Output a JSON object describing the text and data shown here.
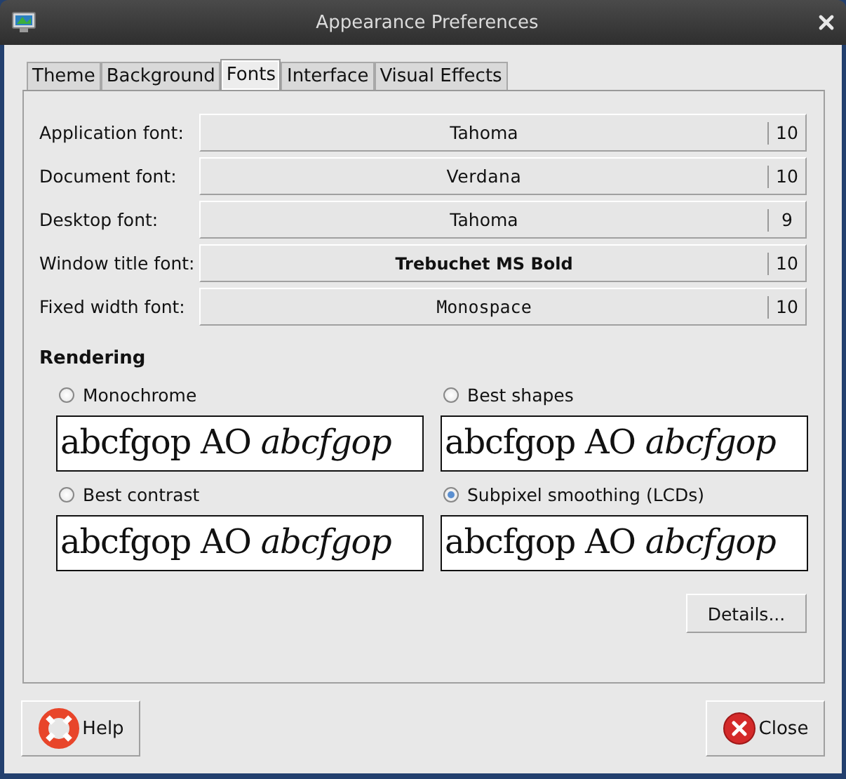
{
  "window": {
    "title": "Appearance Preferences"
  },
  "tabs": [
    {
      "label": "Theme",
      "selected": false
    },
    {
      "label": "Background",
      "selected": false
    },
    {
      "label": "Fonts",
      "selected": true
    },
    {
      "label": "Interface",
      "selected": false
    },
    {
      "label": "Visual Effects",
      "selected": false
    }
  ],
  "fonts": [
    {
      "label": "Application font:",
      "font": "Tahoma",
      "size": "10",
      "kind": "regular"
    },
    {
      "label": "Document font:",
      "font": "Verdana",
      "size": "10",
      "kind": "wide"
    },
    {
      "label": "Desktop font:",
      "font": "Tahoma",
      "size": "9",
      "kind": "regular"
    },
    {
      "label": "Window title font:",
      "font": "Trebuchet MS Bold",
      "size": "10",
      "kind": "bold"
    },
    {
      "label": "Fixed width font:",
      "font": "Monospace",
      "size": "10",
      "kind": "mono"
    }
  ],
  "rendering": {
    "heading": "Rendering",
    "options": [
      {
        "label": "Monochrome",
        "selected": false,
        "sample": "abcfgop AO *abcfgop*"
      },
      {
        "label": "Best shapes",
        "selected": false,
        "sample": "abcfgop AO *abcfgop*"
      },
      {
        "label": "Best contrast",
        "selected": false,
        "sample": "abcfgop AO *abcfgop*"
      },
      {
        "label": "Subpixel smoothing (LCDs)",
        "selected": true,
        "sample": "abcfgop AO *abcfgop*"
      }
    ]
  },
  "details_button": "Details...",
  "buttons": [
    {
      "label": "Help",
      "kind": "help"
    },
    {
      "label": "Close",
      "kind": "close"
    }
  ]
}
